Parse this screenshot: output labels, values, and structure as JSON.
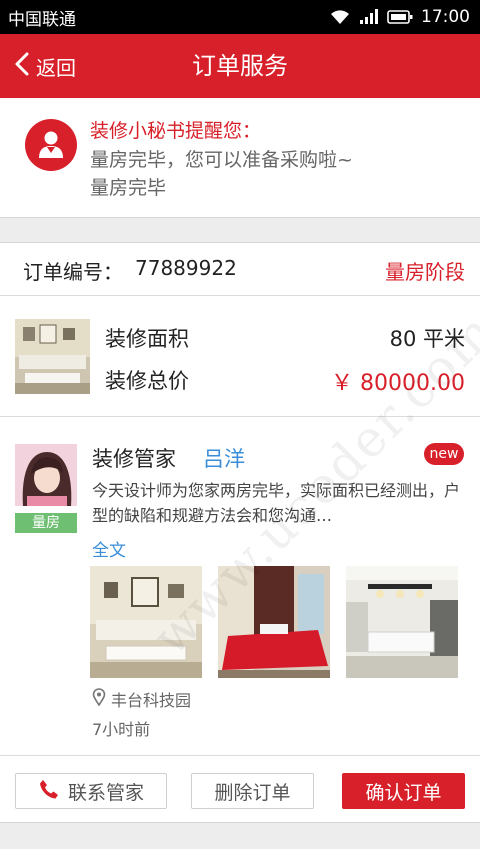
{
  "status_bar": {
    "carrier": "中国联通",
    "time": "17:00",
    "icons": [
      "wifi-icon",
      "signal-icon",
      "battery-icon"
    ]
  },
  "nav": {
    "back_label": "返回",
    "title": "订单服务"
  },
  "notice": {
    "title": "装修小秘书提醒您：",
    "line1": "量房完毕，您可以准备采购啦~",
    "line2": "量房完毕"
  },
  "order": {
    "label": "订单编号：",
    "number": "77889922",
    "stage": "量房阶段"
  },
  "info": {
    "area_label": "装修面积",
    "area_value": "80 平米",
    "price_label": "装修总价",
    "price_value": "￥ 80000.00"
  },
  "post": {
    "stage_tag": "量房",
    "manager_label": "装修管家",
    "manager_name": "吕洋",
    "badge": "new",
    "text": "今天设计师为您家两房完毕，实际面积已经测出，户型的缺陷和规避方法会和您沟通…",
    "full_text_link": "全文",
    "location": "丰台科技园",
    "time_ago": "7小时前"
  },
  "actions": {
    "contact": "联系管家",
    "delete": "删除订单",
    "confirm": "确认订单"
  },
  "watermark": "www.ucoder.com",
  "colors": {
    "brand": "#d8202a",
    "link": "#3a8dd8",
    "tag_green": "#6fbf73"
  }
}
